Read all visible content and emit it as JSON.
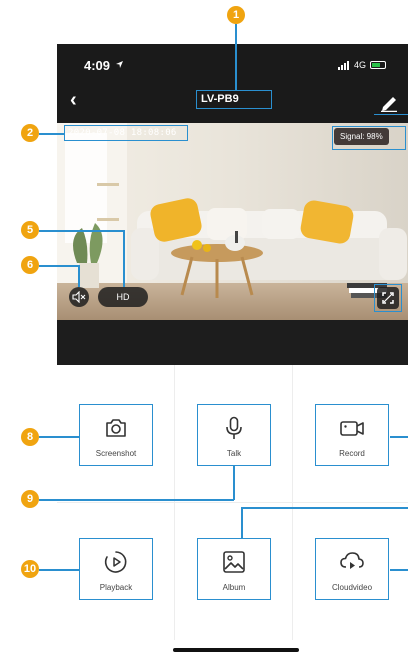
{
  "status_bar": {
    "time": "4:09",
    "network": "4G"
  },
  "header": {
    "title": "LV-PB9"
  },
  "video": {
    "timestamp": "2020-07-08 18:08:06",
    "signal": "Signal: 98%"
  },
  "video_controls": {
    "hd_label": "HD"
  },
  "controls": [
    {
      "label": "Screenshot",
      "icon": "camera-icon"
    },
    {
      "label": "Talk",
      "icon": "microphone-icon"
    },
    {
      "label": "Record",
      "icon": "video-camera-icon"
    },
    {
      "label": "Playback",
      "icon": "playback-icon"
    },
    {
      "label": "Album",
      "icon": "image-icon"
    },
    {
      "label": "Cloudvideo",
      "icon": "cloud-play-icon"
    }
  ],
  "markers": [
    "1",
    "2",
    "5",
    "6",
    "8",
    "9",
    "10"
  ],
  "colors": {
    "marker": "#f0a410",
    "callout": "#2a8fcf",
    "top_bar": "#1a1a1a"
  }
}
